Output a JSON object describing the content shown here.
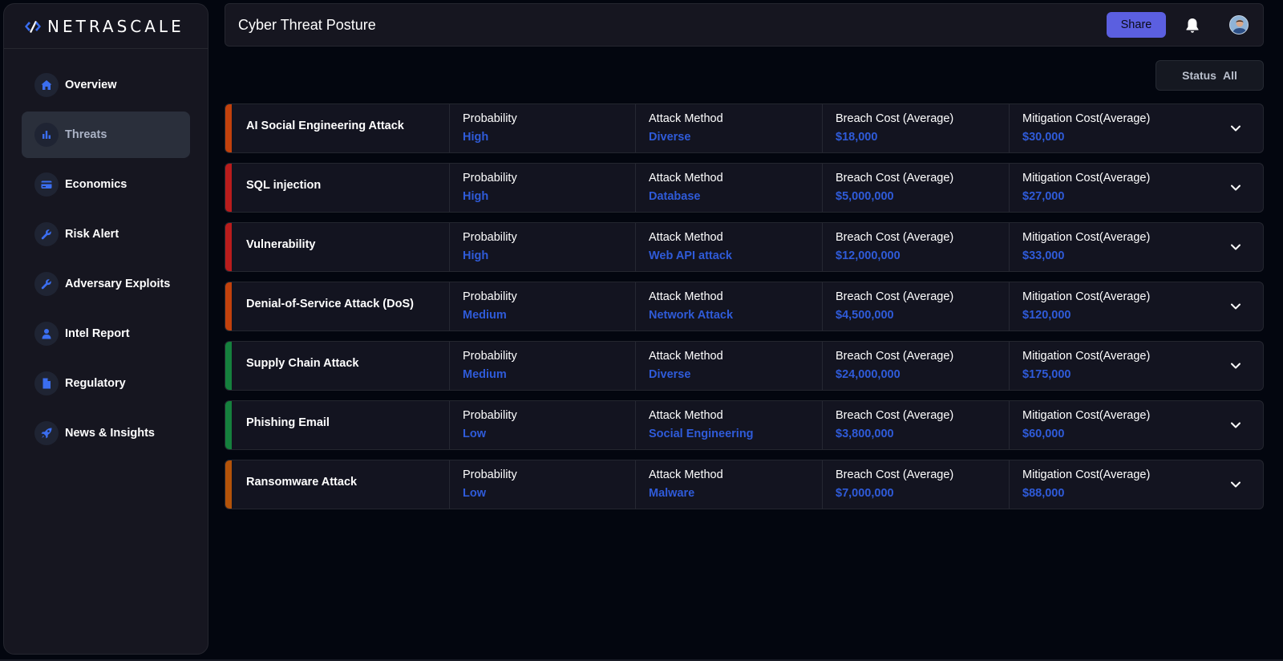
{
  "brand": {
    "name": "NETRASCALE"
  },
  "sidebar": {
    "items": [
      {
        "label": "Overview",
        "icon": "home-icon",
        "active": false
      },
      {
        "label": "Threats",
        "icon": "bar-chart-icon",
        "active": true
      },
      {
        "label": "Economics",
        "icon": "credit-card-icon",
        "active": false
      },
      {
        "label": "Risk Alert",
        "icon": "wrench-icon",
        "active": false
      },
      {
        "label": "Adversary Exploits",
        "icon": "wrench-icon",
        "active": false
      },
      {
        "label": "Intel Report",
        "icon": "user-icon",
        "active": false
      },
      {
        "label": "Regulatory",
        "icon": "document-icon",
        "active": false
      },
      {
        "label": "News & Insights",
        "icon": "rocket-icon",
        "active": false
      }
    ]
  },
  "header": {
    "title": "Cyber Threat Posture",
    "share_label": "Share"
  },
  "filter": {
    "label": "Status",
    "value": "All"
  },
  "columns": {
    "probability": "Probability",
    "method": "Attack Method",
    "breach": "Breach Cost (Average)",
    "mitigation": "Mitigation Cost(Average)"
  },
  "threats": [
    {
      "name": "AI Social Engineering Attack",
      "probability": "High",
      "method": "Diverse",
      "breach": "$18,000",
      "mitigation": "$30,000",
      "color": "#c2410c"
    },
    {
      "name": "SQL injection",
      "probability": "High",
      "method": "Database",
      "breach": "$5,000,000",
      "mitigation": "$27,000",
      "color": "#b91c1c"
    },
    {
      "name": "Vulnerability",
      "probability": "High",
      "method": "Web API attack",
      "breach": "$12,000,000",
      "mitigation": "$33,000",
      "color": "#b91c1c"
    },
    {
      "name": "Denial-of-Service Attack (DoS)",
      "probability": "Medium",
      "method": "Network Attack",
      "breach": "$4,500,000",
      "mitigation": "$120,000",
      "color": "#c2410c"
    },
    {
      "name": "Supply Chain Attack",
      "probability": "Medium",
      "method": "Diverse",
      "breach": "$24,000,000",
      "mitigation": "$175,000",
      "color": "#15803d"
    },
    {
      "name": "Phishing Email",
      "probability": "Low",
      "method": "Social Engineering",
      "breach": "$3,800,000",
      "mitigation": "$60,000",
      "color": "#15803d"
    },
    {
      "name": "Ransomware Attack",
      "probability": "Low",
      "method": "Malware",
      "breach": "$7,000,000",
      "mitigation": "$88,000",
      "color": "#b45309"
    }
  ],
  "colors": {
    "accent": "#5b5fe0",
    "value_text": "#2f5bd9",
    "background": "#03060f"
  }
}
